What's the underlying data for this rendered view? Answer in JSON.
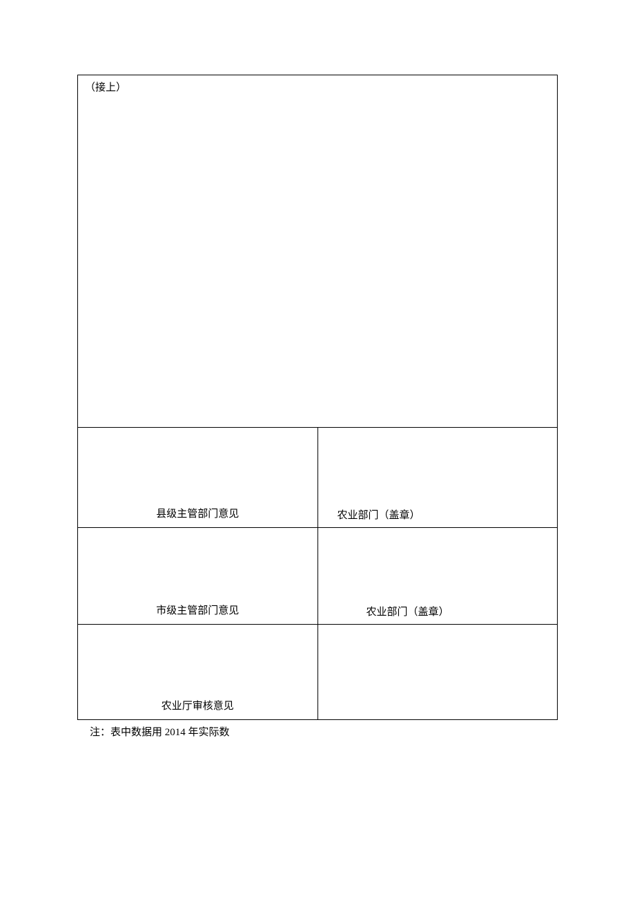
{
  "continued_label": "（接上）",
  "rows": {
    "county": {
      "label": "县级主管部门意见",
      "content": "农业部门（盖章）"
    },
    "city": {
      "label": "市级主管部门意见",
      "content": "农业部门（盖章）"
    },
    "dept": {
      "label": "农业厅审核意见",
      "content": ""
    }
  },
  "footnote": "注：表中数据用 2014 年实际数"
}
